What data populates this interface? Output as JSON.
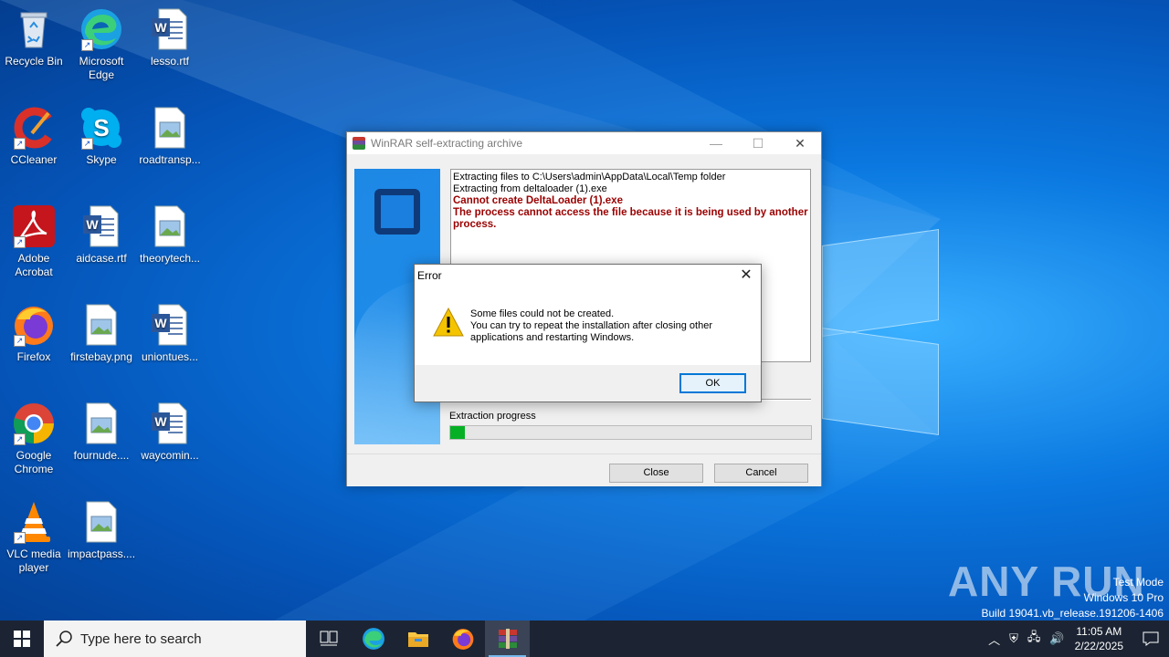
{
  "desktop": {
    "icons": [
      {
        "label": "Recycle Bin",
        "icon": "recycle-bin-icon"
      },
      {
        "label": "Microsoft Edge",
        "icon": "edge-icon"
      },
      {
        "label": "lesso.rtf",
        "icon": "word-doc-icon"
      },
      {
        "label": "CCleaner",
        "icon": "ccleaner-icon"
      },
      {
        "label": "Skype",
        "icon": "skype-icon"
      },
      {
        "label": "roadtransp...",
        "icon": "image-file-icon"
      },
      {
        "label": "Adobe Acrobat",
        "icon": "acrobat-icon"
      },
      {
        "label": "aidcase.rtf",
        "icon": "word-doc-icon"
      },
      {
        "label": "theorytech...",
        "icon": "image-file-icon"
      },
      {
        "label": "Firefox",
        "icon": "firefox-icon"
      },
      {
        "label": "firstebay.png",
        "icon": "image-file-icon"
      },
      {
        "label": "uniontues...",
        "icon": "word-doc-icon"
      },
      {
        "label": "Google Chrome",
        "icon": "chrome-icon"
      },
      {
        "label": "fournude....",
        "icon": "image-file-icon"
      },
      {
        "label": "waycomin...",
        "icon": "word-doc-icon"
      },
      {
        "label": "VLC media player",
        "icon": "vlc-icon"
      },
      {
        "label": "impactpass....",
        "icon": "image-file-icon"
      }
    ]
  },
  "winrar": {
    "title": "WinRAR self-extracting archive",
    "log": {
      "line1": "Extracting files to C:\\Users\\admin\\AppData\\Local\\Temp folder",
      "line2": "Extracting from deltaloader (1).exe",
      "error1": "Cannot create DeltaLoader (1).exe",
      "error2": "The process cannot access the file because it is being used by another process."
    },
    "progress_label": "Extraction progress",
    "progress_fraction": 0.04,
    "close_label": "Close",
    "cancel_label": "Cancel"
  },
  "error_dialog": {
    "title": "Error",
    "message_line1": "Some files could not be created.",
    "message_line2": "You can try to repeat the installation after closing other",
    "message_line3": "applications and restarting Windows.",
    "ok_label": "OK"
  },
  "watermark": {
    "brand": "ANY RUN",
    "line1": "Test Mode",
    "line2": "Windows 10 Pro",
    "line3": "Build 19041.vb_release.191206-1406"
  },
  "taskbar": {
    "search_placeholder": "Type here to search",
    "time": "11:05 AM",
    "date": "2/22/2025",
    "accent": "#76b9ed"
  }
}
